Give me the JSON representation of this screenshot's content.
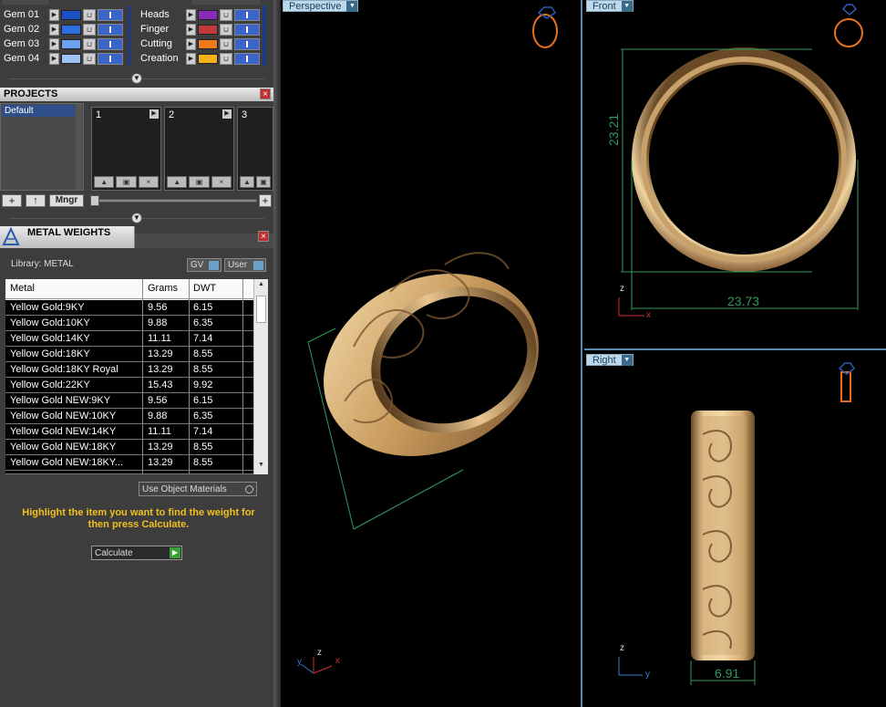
{
  "layers": {
    "left": [
      {
        "label": "Gem 01",
        "color": "#1b4fc4"
      },
      {
        "label": "Gem 02",
        "color": "#2e6fe0"
      },
      {
        "label": "Gem 03",
        "color": "#6aa2f0"
      },
      {
        "label": "Gem 04",
        "color": "#9ec4f6"
      }
    ],
    "right": [
      {
        "label": "Heads",
        "color": "#8a2ab8"
      },
      {
        "label": "Finger",
        "color": "#c03a3a"
      },
      {
        "label": "Cutting",
        "color": "#ee7a1c"
      },
      {
        "label": "Creation",
        "color": "#f2b21a"
      }
    ]
  },
  "projects": {
    "title": "PROJECTS",
    "list_selected": "Default",
    "slots": [
      "1",
      "2",
      "3"
    ],
    "add_label": "+",
    "up_label": "↑",
    "manager_label": "Mngr",
    "zoom_plus": "+"
  },
  "metal_weights": {
    "title": "METAL WEIGHTS",
    "library_label": "Library: METAL",
    "gv_label": "GV",
    "user_label": "User",
    "columns": [
      "Metal",
      "Grams",
      "DWT"
    ],
    "rows": [
      [
        "Yellow Gold:9KY",
        "9.56",
        "6.15"
      ],
      [
        "Yellow Gold:10KY",
        "9.88",
        "6.35"
      ],
      [
        "Yellow Gold:14KY",
        "11.11",
        "7.14"
      ],
      [
        "Yellow Gold:18KY",
        "13.29",
        "8.55"
      ],
      [
        "Yellow Gold:18KY Royal",
        "13.29",
        "8.55"
      ],
      [
        "Yellow Gold:22KY",
        "15.43",
        "9.92"
      ],
      [
        "Yellow Gold NEW:9KY",
        "9.56",
        "6.15"
      ],
      [
        "Yellow Gold NEW:10KY",
        "9.88",
        "6.35"
      ],
      [
        "Yellow Gold NEW:14KY",
        "11.11",
        "7.14"
      ],
      [
        "Yellow Gold NEW:18KY",
        "13.29",
        "8.55"
      ],
      [
        "Yellow Gold NEW:18KY...",
        "13.29",
        "8.55"
      ]
    ],
    "use_object_materials": "Use Object Materials",
    "instructions": "Highlight the item you want to find the weight for then press Calculate.",
    "calculate_label": "Calculate"
  },
  "viewports": {
    "perspective": {
      "label": "Perspective"
    },
    "front": {
      "label": "Front",
      "height_dim": "23.21",
      "width_dim": "23.73"
    },
    "right": {
      "label": "Right",
      "width_dim": "6.91"
    }
  },
  "axes": {
    "x": "x",
    "y": "y",
    "z": "z"
  },
  "colors": {
    "accent": "#f0c020",
    "dimension": "#2f9a5a",
    "gold": "#d9b07a"
  }
}
